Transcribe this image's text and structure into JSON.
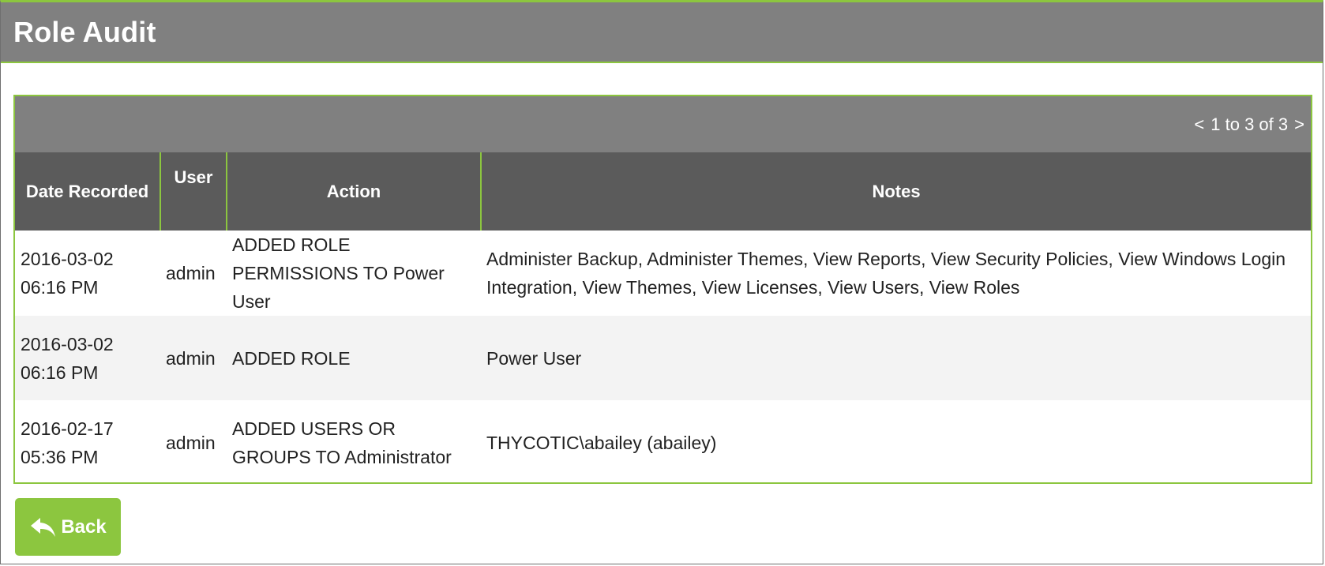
{
  "header": {
    "title": "Role Audit"
  },
  "pager": {
    "prev": "<",
    "range": "1 to 3 of 3",
    "next": ">"
  },
  "table": {
    "columns": {
      "date": "Date Recorded",
      "user": "User",
      "action": "Action",
      "notes": "Notes"
    },
    "rows": [
      {
        "date": "2016-03-02",
        "time": "06:16 PM",
        "user": "admin",
        "action": "ADDED ROLE PERMISSIONS TO Power User",
        "notes": "Administer Backup, Administer Themes, View Reports, View Security Policies, View Windows Login Integration, View Themes, View Licenses, View Users, View Roles"
      },
      {
        "date": "2016-03-02",
        "time": "06:16 PM",
        "user": "admin",
        "action": "ADDED ROLE",
        "notes": "Power User"
      },
      {
        "date": "2016-02-17",
        "time": "05:36 PM",
        "user": "admin",
        "action": "ADDED USERS OR GROUPS TO Administrator",
        "notes": "THYCOTIC\\abailey (abailey)"
      }
    ]
  },
  "back_button": {
    "label": "Back",
    "icon": "reply-arrow-icon"
  },
  "colors": {
    "accent": "#8cc63f",
    "header_bg": "#808080",
    "column_header_bg": "#5b5b5b",
    "alt_row_bg": "#f3f3f3"
  }
}
